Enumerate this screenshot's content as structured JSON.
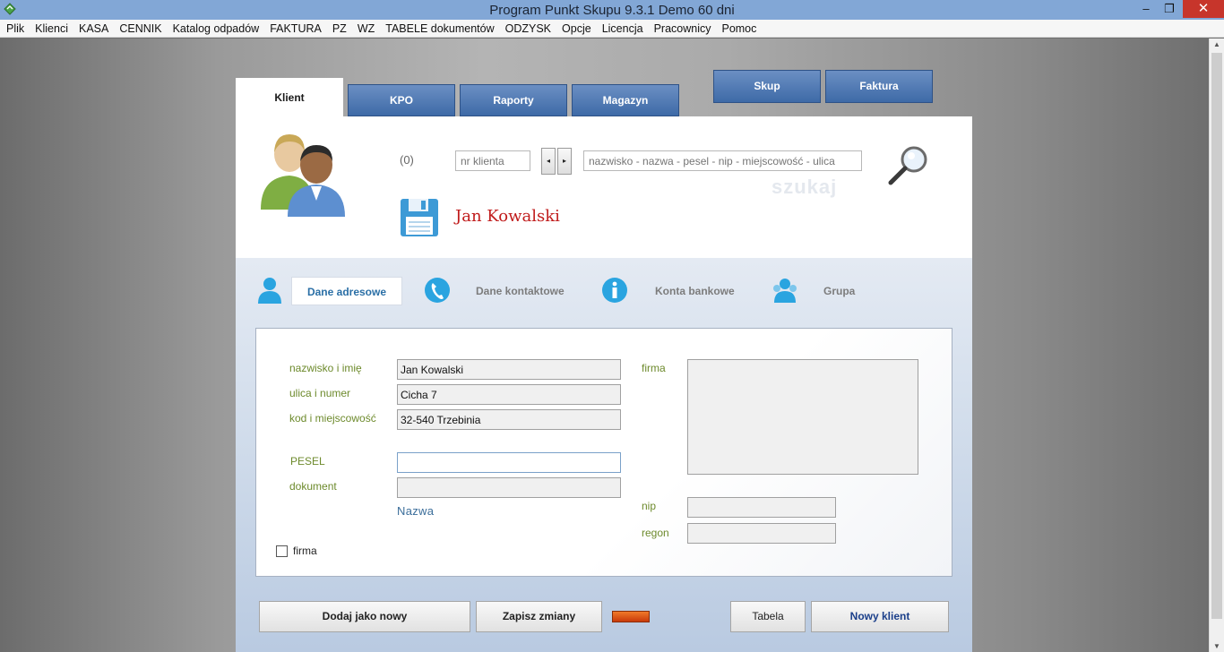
{
  "window": {
    "title": "Program Punkt Skupu 9.3.1   Demo 60 dni",
    "minimize": "–",
    "maximize": "❐",
    "close": "✕"
  },
  "menu": [
    "Plik",
    "Klienci",
    "KASA",
    "CENNIK",
    "Katalog odpadów",
    "FAKTURA",
    "PZ",
    "WZ",
    "TABELE dokumentów",
    "ODZYSK",
    "Opcje",
    "Licencja",
    "Pracownicy",
    "Pomoc"
  ],
  "tabs": {
    "klient": "Klient",
    "kpo": "KPO",
    "raporty": "Raporty",
    "magazyn": "Magazyn"
  },
  "top_buttons": {
    "skup": "Skup",
    "faktura": "Faktura"
  },
  "client_header": {
    "count": "(0)",
    "nr_placeholder": "nr klienta",
    "prev": "◂",
    "next": "▸",
    "search_placeholder": "nazwisko - nazwa - pesel - nip - miejscowość - ulica",
    "search_watermark": "szukaj",
    "client_name": "Jan Kowalski"
  },
  "subtabs": {
    "adres": "Dane adresowe",
    "kontakt": "Dane kontaktowe",
    "konta": "Konta bankowe",
    "grupa": "Grupa"
  },
  "form": {
    "labels": {
      "nazwisko": "nazwisko i imię",
      "ulica": "ulica i numer",
      "kod": "kod i miejscowość",
      "pesel": "PESEL",
      "dokument": "dokument",
      "firma": "firma",
      "nip": "nip",
      "regon": "regon"
    },
    "values": {
      "nazwisko": "Jan Kowalski",
      "ulica": "Cicha 7",
      "kod": "32-540 Trzebinia",
      "pesel": "",
      "dokument": "",
      "nip": "",
      "regon": ""
    },
    "nazwa_link": "Nazwa",
    "firma_checkbox": "firma"
  },
  "bottom_buttons": {
    "dodaj": "Dodaj jako nowy",
    "zapisz": "Zapisz zmiany",
    "tabela": "Tabela",
    "nowy": "Nowy klient"
  },
  "colors": {
    "titlebar": "#82a7d6",
    "tab_blue": "#4a74ad",
    "label_green": "#6d8a2c",
    "client_name_red": "#c01b1b",
    "active_subtab_blue": "#2a6fa6",
    "status_orange": "#e0611e"
  }
}
